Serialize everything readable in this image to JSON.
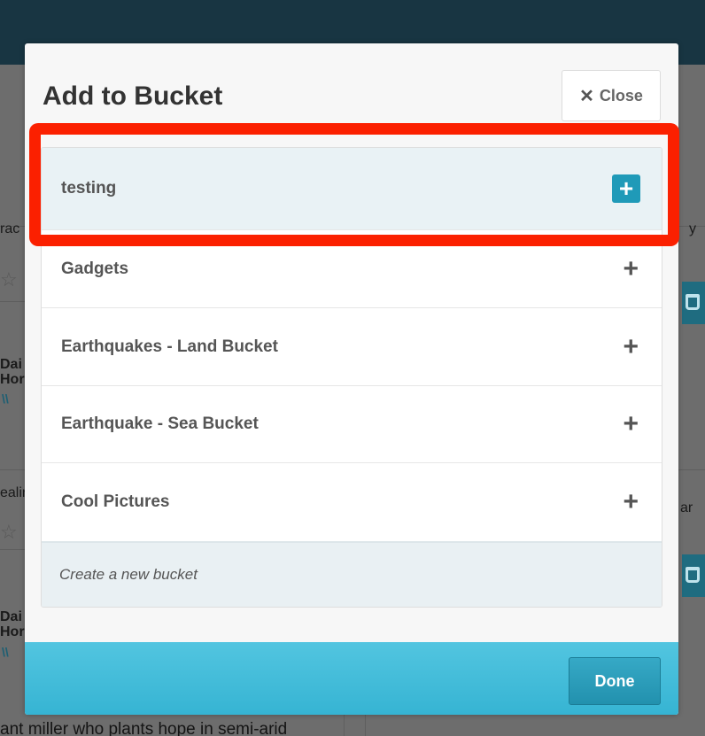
{
  "background": {
    "fragments": [
      "rac",
      "Dai",
      "Hor",
      "ealin",
      "Dai",
      "Hor",
      "y",
      "ar"
    ],
    "bottom_text": "ant miller who plants hope in semi-arid"
  },
  "modal": {
    "title": "Add to Bucket",
    "close_label": "Close",
    "buckets": [
      {
        "label": "testing",
        "active": true
      },
      {
        "label": "Gadgets",
        "active": false
      },
      {
        "label": "Earthquakes - Land Bucket",
        "active": false
      },
      {
        "label": "Earthquake - Sea Bucket",
        "active": false
      },
      {
        "label": "Cool Pictures",
        "active": false
      }
    ],
    "new_bucket_placeholder": "Create a new bucket",
    "done_label": "Done"
  },
  "colors": {
    "accent": "#1f9ab8",
    "footer": "#3fbcd9",
    "highlight": "#fb2000"
  }
}
